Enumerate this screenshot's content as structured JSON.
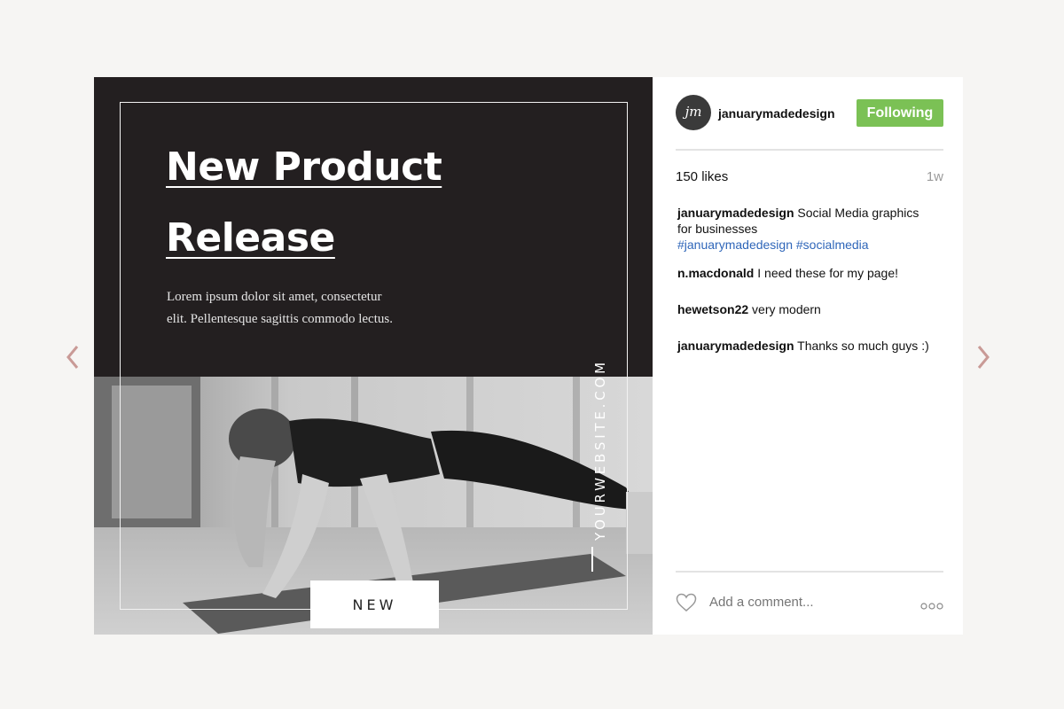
{
  "post": {
    "headline_line1": "New Product",
    "headline_line2": "Release",
    "body_line1": "Lorem ipsum dolor sit amet, consectetur",
    "body_line2": "elit. Pellentesque sagittis commodo lectus.",
    "website": "YOURWEBSITE.COM",
    "tag": "NEW"
  },
  "sidebar": {
    "avatar_initials": "jm",
    "username": "januarymadedesign",
    "follow_label": "Following",
    "likes": "150 likes",
    "age": "1w",
    "caption": {
      "author": "januarymadedesign",
      "text": " Social Media graphics for businesses",
      "tags": "#januarymadedesign #socialmedia"
    },
    "comments": [
      {
        "author": "n.macdonald",
        "text": " I need these for my page!"
      },
      {
        "author": "hewetson22",
        "text": " very modern"
      },
      {
        "author": "januarymadedesign",
        "text": " Thanks so much guys :)"
      }
    ],
    "comment_placeholder": "Add a comment..."
  },
  "icons": {
    "prev": "chevron-left-icon",
    "next": "chevron-right-icon",
    "like": "heart-icon",
    "more": "more-dots-icon"
  },
  "colors": {
    "background": "#f6f5f3",
    "dark_panel": "#231f20",
    "follow_button": "#7bc155",
    "arrow": "#c99a96",
    "hashtag": "#2f66b9"
  }
}
